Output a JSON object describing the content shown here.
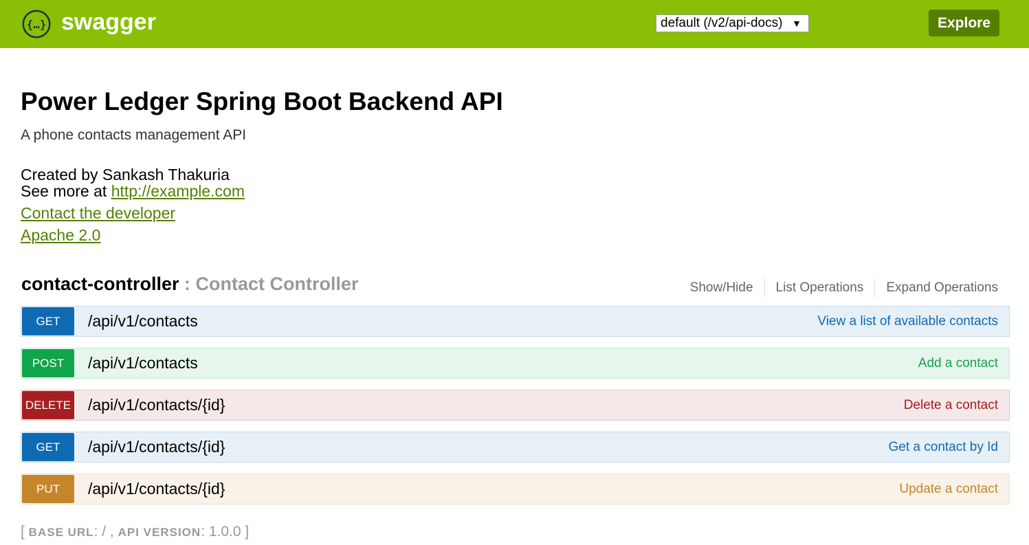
{
  "header": {
    "brand": "swagger",
    "logo_icon": "swagger-braces-icon",
    "api_select_value": "default (/v2/api-docs)",
    "explore_label": "Explore",
    "colors": {
      "bar": "#89bf04",
      "explore": "#547f00"
    }
  },
  "info": {
    "title": "Power Ledger Spring Boot Backend API",
    "description": "A phone contacts management API",
    "created_by": "Created by Sankash Thakuria",
    "see_more_prefix": "See more at ",
    "see_more_link": "http://example.com",
    "contact_link": "Contact the developer",
    "license_link": "Apache 2.0"
  },
  "controller": {
    "name": "contact-controller",
    "separator": " : ",
    "description": "Contact Controller",
    "options": [
      "Show/Hide",
      "List Operations",
      "Expand Operations"
    ]
  },
  "operations": [
    {
      "method": "GET",
      "path": "/api/v1/contacts",
      "summary": "View a list of available contacts",
      "color": "#0f6ab4"
    },
    {
      "method": "POST",
      "path": "/api/v1/contacts",
      "summary": "Add a contact",
      "color": "#10a54a"
    },
    {
      "method": "DELETE",
      "path": "/api/v1/contacts/{id}",
      "summary": "Delete a contact",
      "color": "#a41e22"
    },
    {
      "method": "GET",
      "path": "/api/v1/contacts/{id}",
      "summary": "Get a contact by Id",
      "color": "#0f6ab4"
    },
    {
      "method": "PUT",
      "path": "/api/v1/contacts/{id}",
      "summary": "Update a contact",
      "color": "#c5862b"
    }
  ],
  "footer": {
    "open": "[ ",
    "base_url_label": "BASE URL",
    "base_url_value": ": / , ",
    "api_version_label": "API VERSION",
    "api_version_value": ": 1.0.0",
    "close": " ]"
  }
}
